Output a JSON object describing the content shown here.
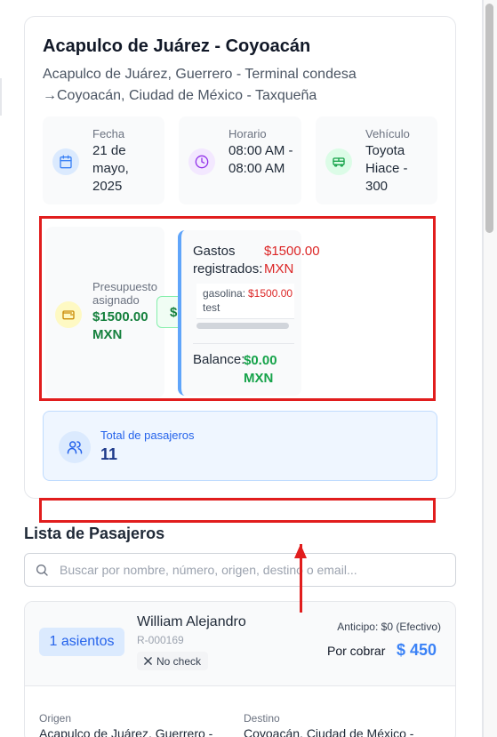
{
  "route": {
    "title": "Acapulco de Juárez - Coyoacán",
    "subtitle_origin": "Acapulco de Juárez, Guerrero - Terminal condesa",
    "subtitle_dest": "→Coyoacán, Ciudad de México - Taxqueña"
  },
  "info": {
    "date_label": "Fecha",
    "date_value": "21 de mayo, 2025",
    "time_label": "Horario",
    "time_value": "08:00 AM - 08:00 AM",
    "vehicle_label": "Vehículo",
    "vehicle_value": "Toyota Hiace - 300"
  },
  "budget": {
    "label": "Presupuesto asignado",
    "value": "$1500.00 MXN",
    "chip": "$"
  },
  "expenses": {
    "label": "Gastos registrados:",
    "value": "$1500.00 MXN",
    "items": [
      {
        "name": "gasolina:",
        "amount": "$1500.00",
        "note": "test"
      }
    ],
    "balance_label": "Balance:",
    "balance_value": "$0.00 MXN"
  },
  "passenger_total": {
    "label": "Total de pasajeros",
    "value": "11"
  },
  "passenger_list": {
    "title": "Lista de Pasajeros",
    "search_placeholder": "Buscar por nombre, número, origen, destino o email..."
  },
  "passengers": [
    {
      "seats": "1 asientos",
      "name": "William Alejandro",
      "code": "R-000169",
      "check_status": "No check",
      "anticipo": "Anticipo: $0 (Efectivo)",
      "por_cobrar_label": "Por cobrar",
      "por_cobrar_value": "$ 450",
      "origen_label": "Origen",
      "origen_value": "Acapulco de Juárez, Guerrero -",
      "destino_label": "Destino",
      "destino_value": "Coyoacán, Ciudad de México -"
    }
  ],
  "colors": {
    "annotation_red": "#e11d1d",
    "accent_blue": "#3b82f6",
    "money_green": "#15803d",
    "expense_red": "#dc2626"
  }
}
